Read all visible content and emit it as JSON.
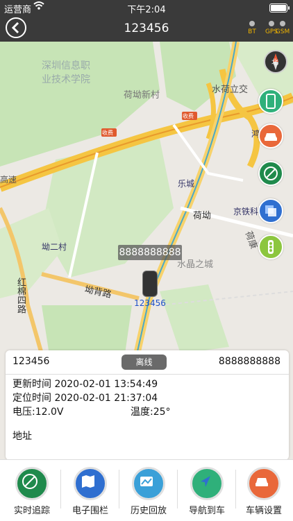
{
  "status_bar": {
    "carrier": "运营商",
    "time": "下午2:04"
  },
  "nav": {
    "title": "123456"
  },
  "indicators": [
    "BT",
    "GPS",
    "GSM"
  ],
  "map": {
    "places": [
      "深圳信息职",
      "业技术学院",
      "荷坳新村",
      "水荷立交",
      "鸿丰泰",
      "乐城",
      "荷坳",
      "京铁科",
      "荷康",
      "坳二村",
      "坳背路",
      "红棉四路",
      "水晶之城",
      "高速",
      "收费",
      "收费",
      "北"
    ],
    "vehicle_label": "8888888888",
    "vehicle_name": "123456"
  },
  "info": {
    "name": "123456",
    "status": "离线",
    "phone": "8888888888",
    "update_time": "更新时间 2020-02-01 13:54:49",
    "locate_time": "定位时间 2020-02-01 21:37:04",
    "voltage": "电压:12.0V",
    "temperature": "温度:25°",
    "address": "地址"
  },
  "toolbar": [
    "实时追踪",
    "电子围栏",
    "历史回放",
    "导航到车",
    "车辆设置"
  ]
}
